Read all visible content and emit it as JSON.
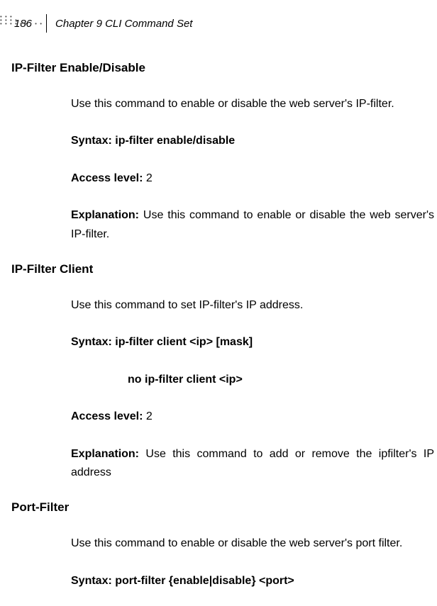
{
  "header": {
    "page_number": "186",
    "chapter": "Chapter 9 CLI Command Set"
  },
  "sections": [
    {
      "title": "IP-Filter Enable/Disable",
      "intro": "Use this command to enable or disable the web server's IP-filter.",
      "syntax_label": "Syntax:",
      "syntax": " ip-filter enable/disable",
      "syntax2": "",
      "access_label": "Access level:",
      "access": " 2",
      "explanation_label": "Explanation:",
      "explanation": " Use this command to enable or disable the web server's IP-filter."
    },
    {
      "title": "IP-Filter Client",
      "intro": " Use this command to set IP-filter's IP address.",
      "syntax_label": "Syntax:",
      "syntax": " ip-filter client <ip> [mask]",
      "syntax2": "no ip-filter client <ip>",
      "access_label": "Access level:",
      "access": " 2",
      "explanation_label": "Explanation:",
      "explanation": " Use this command to add or remove the ipfilter's IP address"
    },
    {
      "title": "Port-Filter",
      "intro": "Use this command to enable or disable the web server's port filter.",
      "syntax_label": "Syntax:",
      "syntax": " port-filter {enable|disable} <port>",
      "syntax2": "",
      "access_label": "",
      "access": "",
      "explanation_label": "",
      "explanation": ""
    }
  ]
}
